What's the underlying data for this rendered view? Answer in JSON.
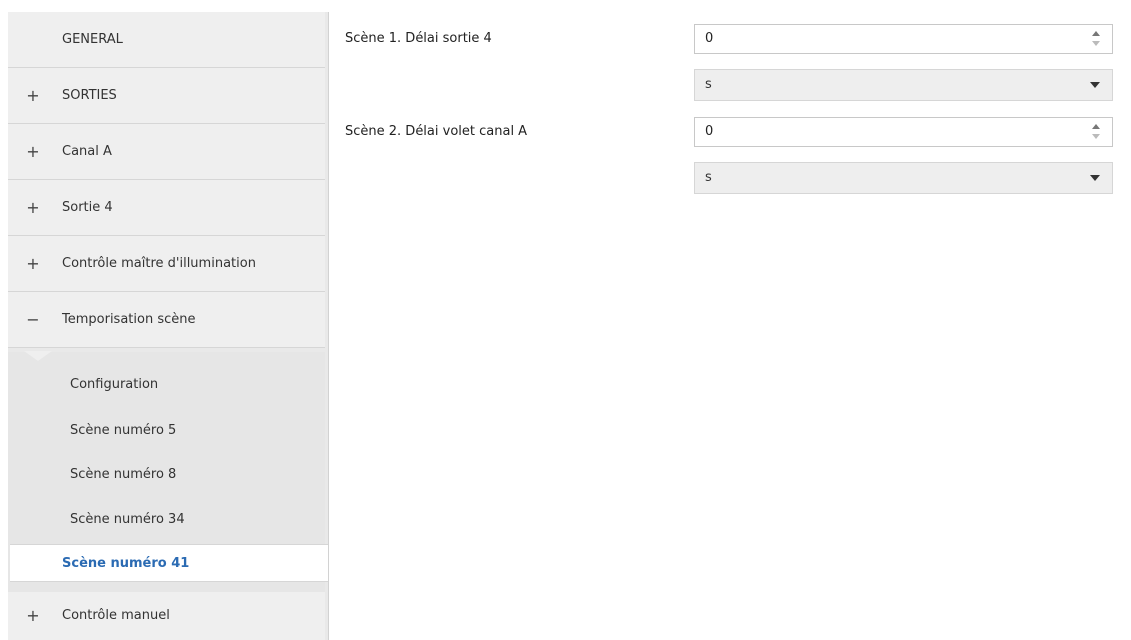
{
  "sidebar": {
    "items": [
      {
        "sign": "",
        "label": "GENERAL"
      },
      {
        "sign": "+",
        "label": "SORTIES"
      },
      {
        "sign": "+",
        "label": "Canal A"
      },
      {
        "sign": "+",
        "label": "Sortie 4"
      },
      {
        "sign": "+",
        "label": "Contrôle maître d'illumination"
      },
      {
        "sign": "−",
        "label": "Temporisation scène"
      },
      {
        "sign": "+",
        "label": "Contrôle manuel"
      }
    ],
    "subitems": [
      {
        "label": "Configuration"
      },
      {
        "label": "Scène numéro 5"
      },
      {
        "label": "Scène numéro 8"
      },
      {
        "label": "Scène numéro 34"
      },
      {
        "label": "Scène numéro 41",
        "active": true
      }
    ]
  },
  "params": [
    {
      "label": "Scène 1. Délai sortie 4",
      "value": "0",
      "unit": "s"
    },
    {
      "label": "Scène 2. Délai volet canal A",
      "value": "0",
      "unit": "s"
    }
  ],
  "colors": {
    "active_text": "#2b6bb3",
    "sidebar_bg": "#efefef"
  }
}
